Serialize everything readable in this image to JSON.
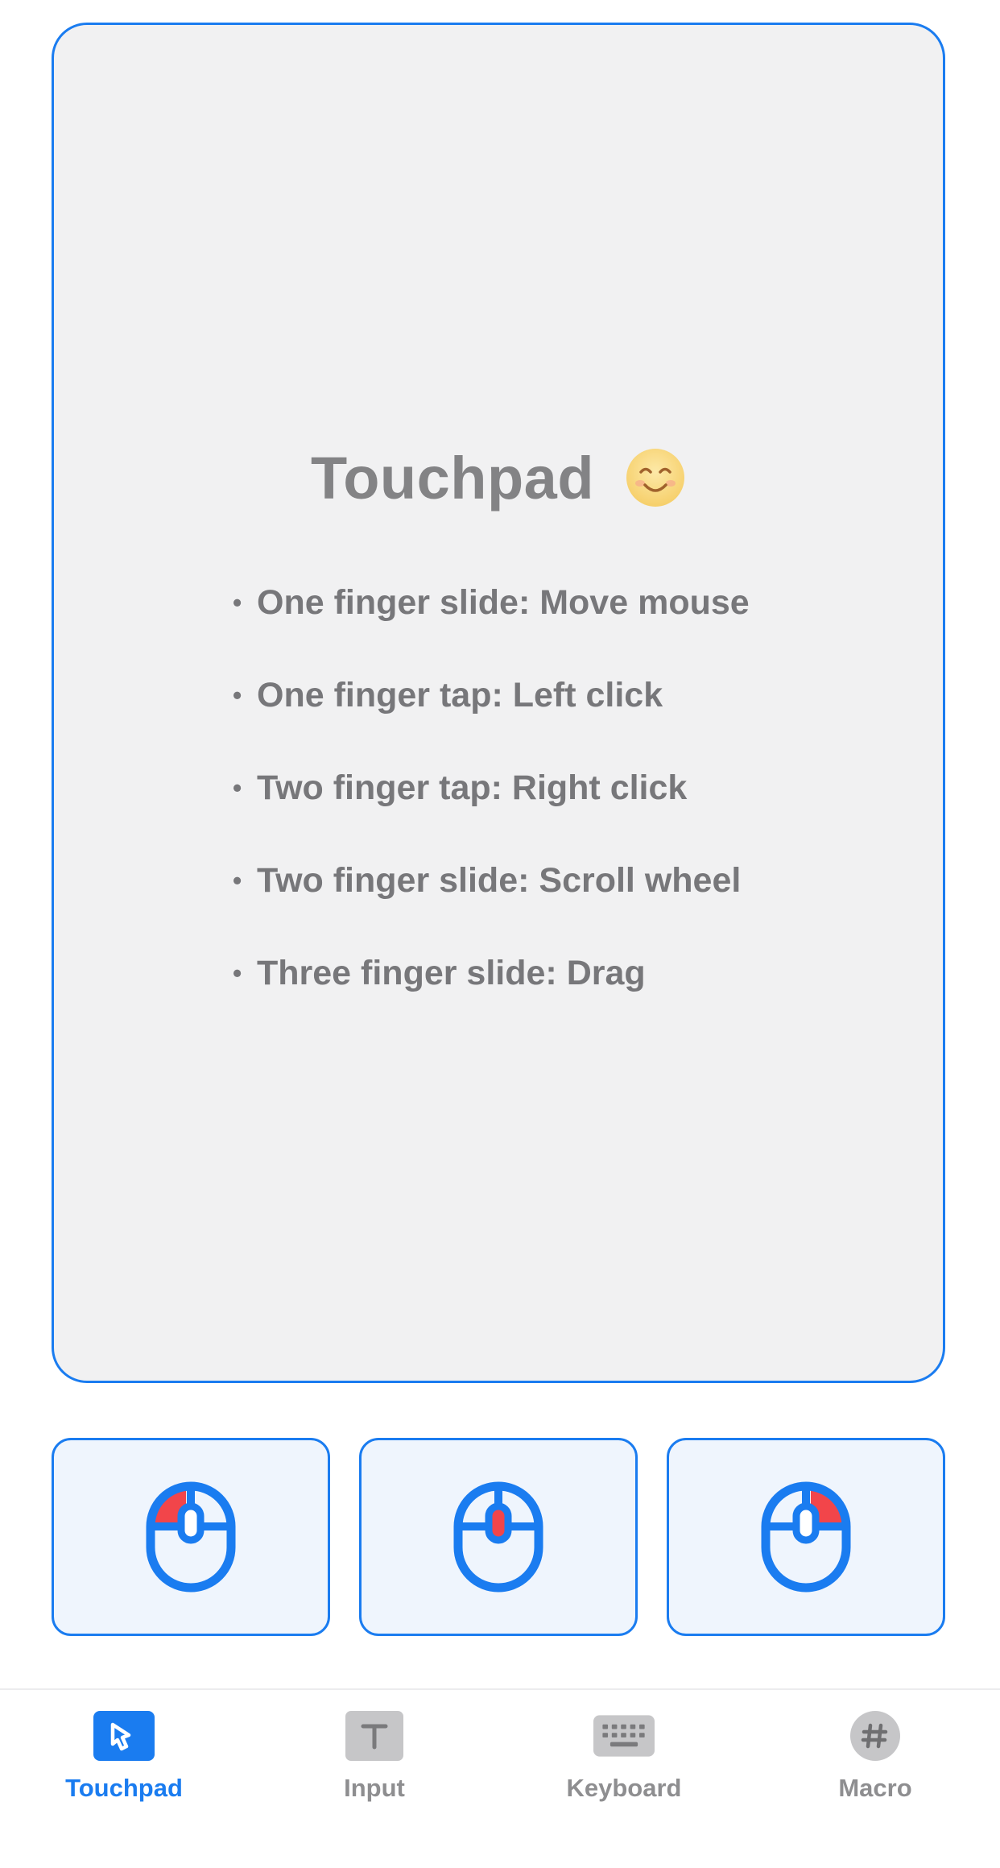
{
  "touchpad": {
    "title": "Touchpad",
    "title_icon": "smiling-face-icon",
    "tips": [
      "One finger slide: Move mouse",
      "One finger tap: Left click",
      "Two finger tap: Right click",
      "Two finger slide: Scroll wheel",
      "Three finger slide: Drag"
    ],
    "bullet": "•"
  },
  "mouse_buttons": [
    {
      "icon": "mouse-left-click-icon"
    },
    {
      "icon": "mouse-middle-click-icon"
    },
    {
      "icon": "mouse-right-click-icon"
    }
  ],
  "tabbar": {
    "active": "touchpad",
    "tabs": [
      {
        "label": "Touchpad",
        "icon": "touchpad-icon"
      },
      {
        "label": "Input",
        "icon": "text-input-icon"
      },
      {
        "label": "Keyboard",
        "icon": "keyboard-icon"
      },
      {
        "label": "Macro",
        "icon": "hash-icon"
      }
    ]
  },
  "colors": {
    "accent": "#1a7cf0",
    "highlight": "#f2454a",
    "inactive": "#8e8e90",
    "pad_background": "#f1f1f2"
  }
}
